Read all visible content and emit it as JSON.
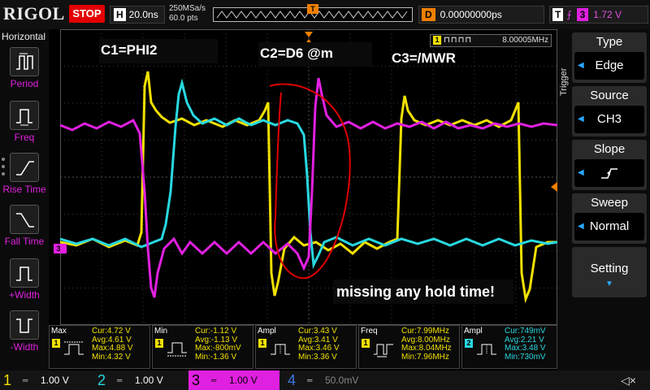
{
  "header": {
    "logo": "RIGOL",
    "run_state": "STOP",
    "timebase_label": "H",
    "timebase": "20.0ns",
    "sample_rate": "250MSa/s",
    "mem_depth": "60.0 pts",
    "trigger_pos_marker": "T",
    "delay_label": "D",
    "delay": "0.00000000ps",
    "trig_label": "T",
    "trig_source": "3",
    "trig_level": "1.72 V"
  },
  "left_panel": {
    "title": "Horizontal",
    "items": [
      {
        "label": "Period",
        "icon": "period-icon"
      },
      {
        "label": "Freq",
        "icon": "freq-icon"
      },
      {
        "label": "Rise Time",
        "icon": "rise-time-icon"
      },
      {
        "label": "Fall Time",
        "icon": "fall-time-icon"
      },
      {
        "label": "+Width",
        "icon": "positive-width-icon"
      },
      {
        "label": "-Width",
        "icon": "negative-width-icon"
      }
    ]
  },
  "right_panel": {
    "side_label": "Trigger",
    "type_head": "Type",
    "type_val": "Edge",
    "source_head": "Source",
    "source_val": "CH3",
    "slope_head": "Slope",
    "sweep_head": "Sweep",
    "sweep_val": "Normal",
    "setting": "Setting"
  },
  "screen": {
    "annotations": {
      "c1": "C1=PHI2",
      "c2": "C2=D6 @m",
      "c3": "C3=/MWR",
      "note": "missing any hold time!"
    },
    "freq_counter": "8.00005MHz",
    "freq_counter_ch": "1",
    "ch3_marker": "3",
    "colors": {
      "ch1": "#f0e000",
      "ch2": "#28d8e0",
      "ch3": "#e020e0",
      "ch4": "#3a78e0",
      "trigger": "#f08000",
      "annotation": "#e00000"
    }
  },
  "measurements": [
    {
      "name": "Max",
      "ch": "1",
      "cur": "Cur:4.72 V",
      "avg": "Avg:4.61 V",
      "max": "Max:4.88 V",
      "min": "Min:4.32 V"
    },
    {
      "name": "Min",
      "ch": "1",
      "cur": "Cur:-1.12 V",
      "avg": "Avg:-1.13 V",
      "max": "Max:-800mV",
      "min": "Min:-1.36 V"
    },
    {
      "name": "Ampl",
      "ch": "1",
      "cur": "Cur:3.43 V",
      "avg": "Avg:3.41 V",
      "max": "Max:3.46 V",
      "min": "Min:3.36 V"
    },
    {
      "name": "Freq",
      "ch": "1",
      "cur": "Cur:7.99MHz",
      "avg": "Avg:8.00MHz",
      "max": "Max:8.04MHz",
      "min": "Min:7.96MHz"
    },
    {
      "name": "Ampl",
      "ch": "2",
      "cur": "Cur:749mV",
      "avg": "Avg:2.21 V",
      "max": "Max:3.48 V",
      "min": "Min:730mV"
    }
  ],
  "channels": [
    {
      "num": "1",
      "scale": "1.00 V"
    },
    {
      "num": "2",
      "scale": "1.00 V"
    },
    {
      "num": "3",
      "scale": "1.00 V"
    },
    {
      "num": "4",
      "scale": "50.0mV"
    }
  ]
}
